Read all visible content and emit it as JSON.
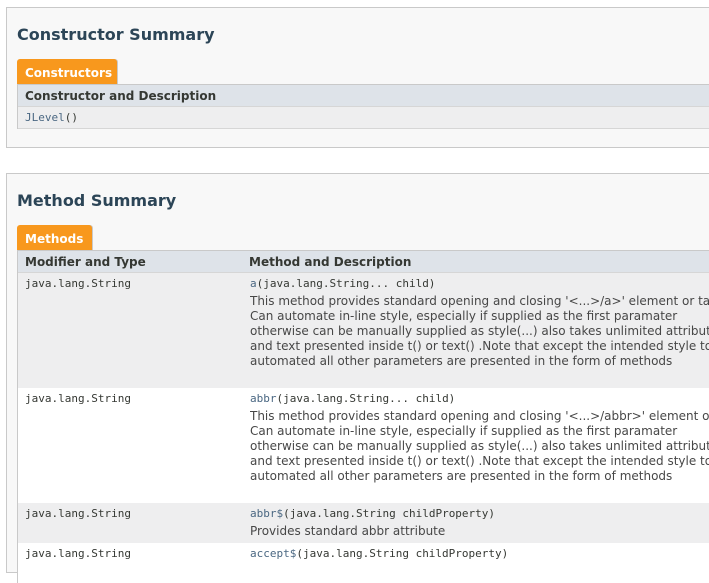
{
  "constructor_summary": {
    "title": "Constructor Summary",
    "tab_label": "Constructors",
    "header": "Constructor and Description",
    "rows": [
      {
        "name": "JLevel",
        "params": "()"
      }
    ]
  },
  "method_summary": {
    "title": "Method Summary",
    "tab_label": "Methods",
    "col1_header": "Modifier and Type",
    "col2_header": "Method and Description",
    "rows": [
      {
        "type": "java.lang.String",
        "name": "a",
        "params": "(java.lang.String... child)",
        "desc": [
          "This method provides standard opening and closing '<...>/a>' element or tag of Htm",
          "Can automate in-line style, especially if supplied as the first paramater",
          "otherwise can be manually supplied as style(...) also takes unlimited attribute",
          "and text presented inside t() or text() .Note that except the intended style to be",
          "automated all other parameters are presented in the form of methods"
        ]
      },
      {
        "type": "java.lang.String",
        "name": "abbr",
        "params": "(java.lang.String... child)",
        "desc": [
          "This method provides standard opening and closing '<...>/abbr>' element or tag of H",
          "Can automate in-line style, especially if supplied as the first paramater",
          "otherwise can be manually supplied as style(...) also takes unlimited attribute",
          "and text presented inside t() or text() .Note that except the intended style to be",
          "automated all other parameters are presented in the form of methods"
        ]
      },
      {
        "type": "java.lang.String",
        "name": "abbr$",
        "params": "(java.lang.String childProperty)",
        "desc": [
          "Provides standard abbr attribute"
        ]
      },
      {
        "type": "java.lang.String",
        "name": "accept$",
        "params": "(java.lang.String childProperty)",
        "desc": []
      }
    ]
  }
}
